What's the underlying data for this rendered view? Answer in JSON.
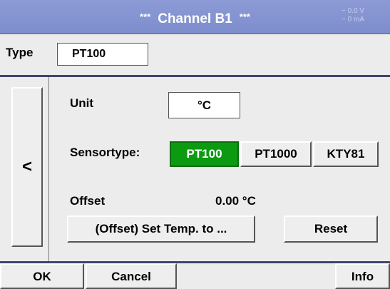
{
  "titlebar": {
    "title_prefix": "***",
    "title": "Channel B1",
    "title_suffix": "***",
    "voltage": "~ 0.0 V",
    "current": "~ 0 mA",
    "background_color": "#8392d2"
  },
  "type_row": {
    "label": "Type",
    "value": "PT100"
  },
  "back_button": {
    "label": "<"
  },
  "unit": {
    "label": "Unit",
    "value": "°C"
  },
  "sensortype": {
    "label": "Sensortype:",
    "options": [
      {
        "label": "PT100",
        "selected": true
      },
      {
        "label": "PT1000",
        "selected": false
      },
      {
        "label": "KTY81",
        "selected": false
      }
    ],
    "selected_color": "#0b9a10"
  },
  "offset": {
    "label": "Offset",
    "value": "0.00 °C"
  },
  "actions": {
    "set_temp": "(Offset) Set Temp. to ...",
    "reset": "Reset"
  },
  "bottom_bar": {
    "ok": "OK",
    "cancel": "Cancel",
    "info": "Info"
  }
}
